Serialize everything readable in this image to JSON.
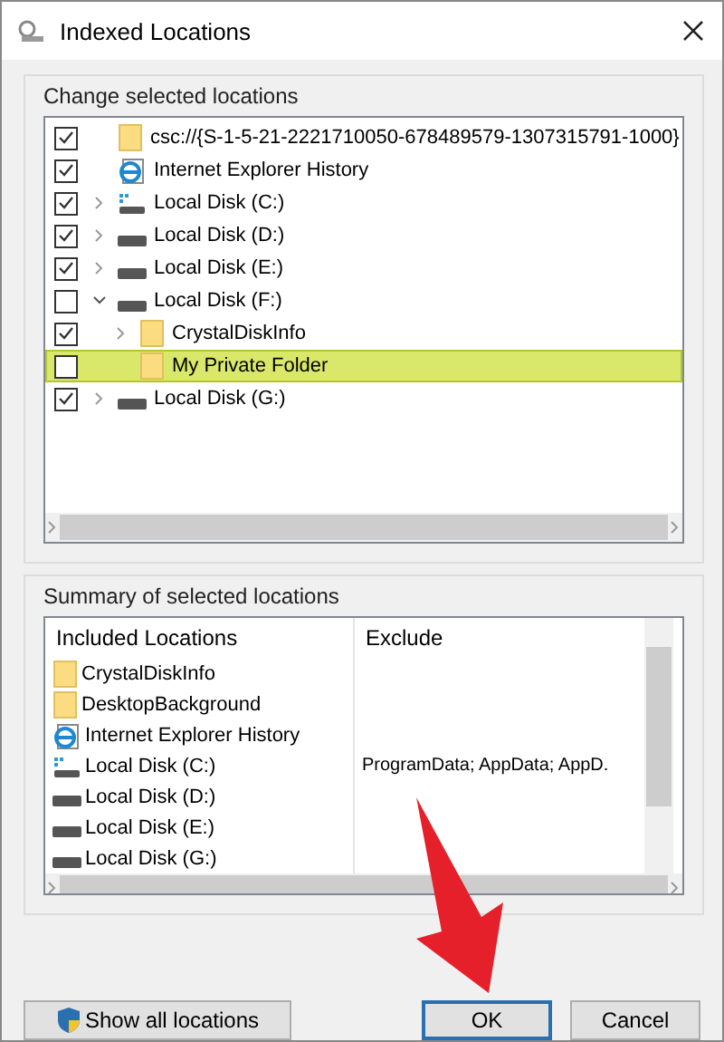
{
  "window": {
    "title": "Indexed Locations"
  },
  "change_group": {
    "title": "Change selected locations",
    "tree": [
      {
        "label": "csc://{S-1-5-21-2221710050-678489579-1307315791-1000}",
        "kind": "folder",
        "checked": true,
        "selected": false
      },
      {
        "label": "Internet Explorer History",
        "kind": "ie",
        "checked": true,
        "selected": false
      },
      {
        "label": "Local Disk (C:)",
        "kind": "system-disk",
        "checked": true,
        "expanded": false,
        "selected": false
      },
      {
        "label": "Local Disk (D:)",
        "kind": "disk",
        "checked": true,
        "expanded": false,
        "selected": false
      },
      {
        "label": "Local Disk (E:)",
        "kind": "disk",
        "checked": true,
        "expanded": false,
        "selected": false
      },
      {
        "label": "Local Disk (F:)",
        "kind": "disk",
        "checked": false,
        "expanded": true,
        "selected": false,
        "children": [
          {
            "label": "CrystalDiskInfo",
            "kind": "folder",
            "checked": true,
            "expanded": false,
            "selected": false
          },
          {
            "label": "My Private Folder",
            "kind": "folder",
            "checked": false,
            "selected": true
          }
        ]
      },
      {
        "label": "Local Disk (G:)",
        "kind": "disk",
        "checked": true,
        "expanded": false,
        "selected": false
      }
    ]
  },
  "summary_group": {
    "title": "Summary of selected locations",
    "columns": [
      "Included Locations",
      "Exclude"
    ],
    "rows": [
      {
        "kind": "folder",
        "included": "CrystalDiskInfo"
      },
      {
        "kind": "folder",
        "included": "DesktopBackground"
      },
      {
        "kind": "ie",
        "included": "Internet Explorer History"
      },
      {
        "kind": "system-disk",
        "included": "Local Disk (C:)",
        "exclude": "ProgramData; AppData; AppD."
      },
      {
        "kind": "disk",
        "included": "Local Disk (D:)"
      },
      {
        "kind": "disk",
        "included": "Local Disk (E:)"
      },
      {
        "kind": "disk",
        "included": "Local Disk (G:)"
      }
    ]
  },
  "buttons": [
    {
      "label": "Show all locations",
      "kind": "shield"
    },
    {
      "label": "OK",
      "kind": "default"
    },
    {
      "label": "Cancel",
      "kind": "plain"
    }
  ]
}
